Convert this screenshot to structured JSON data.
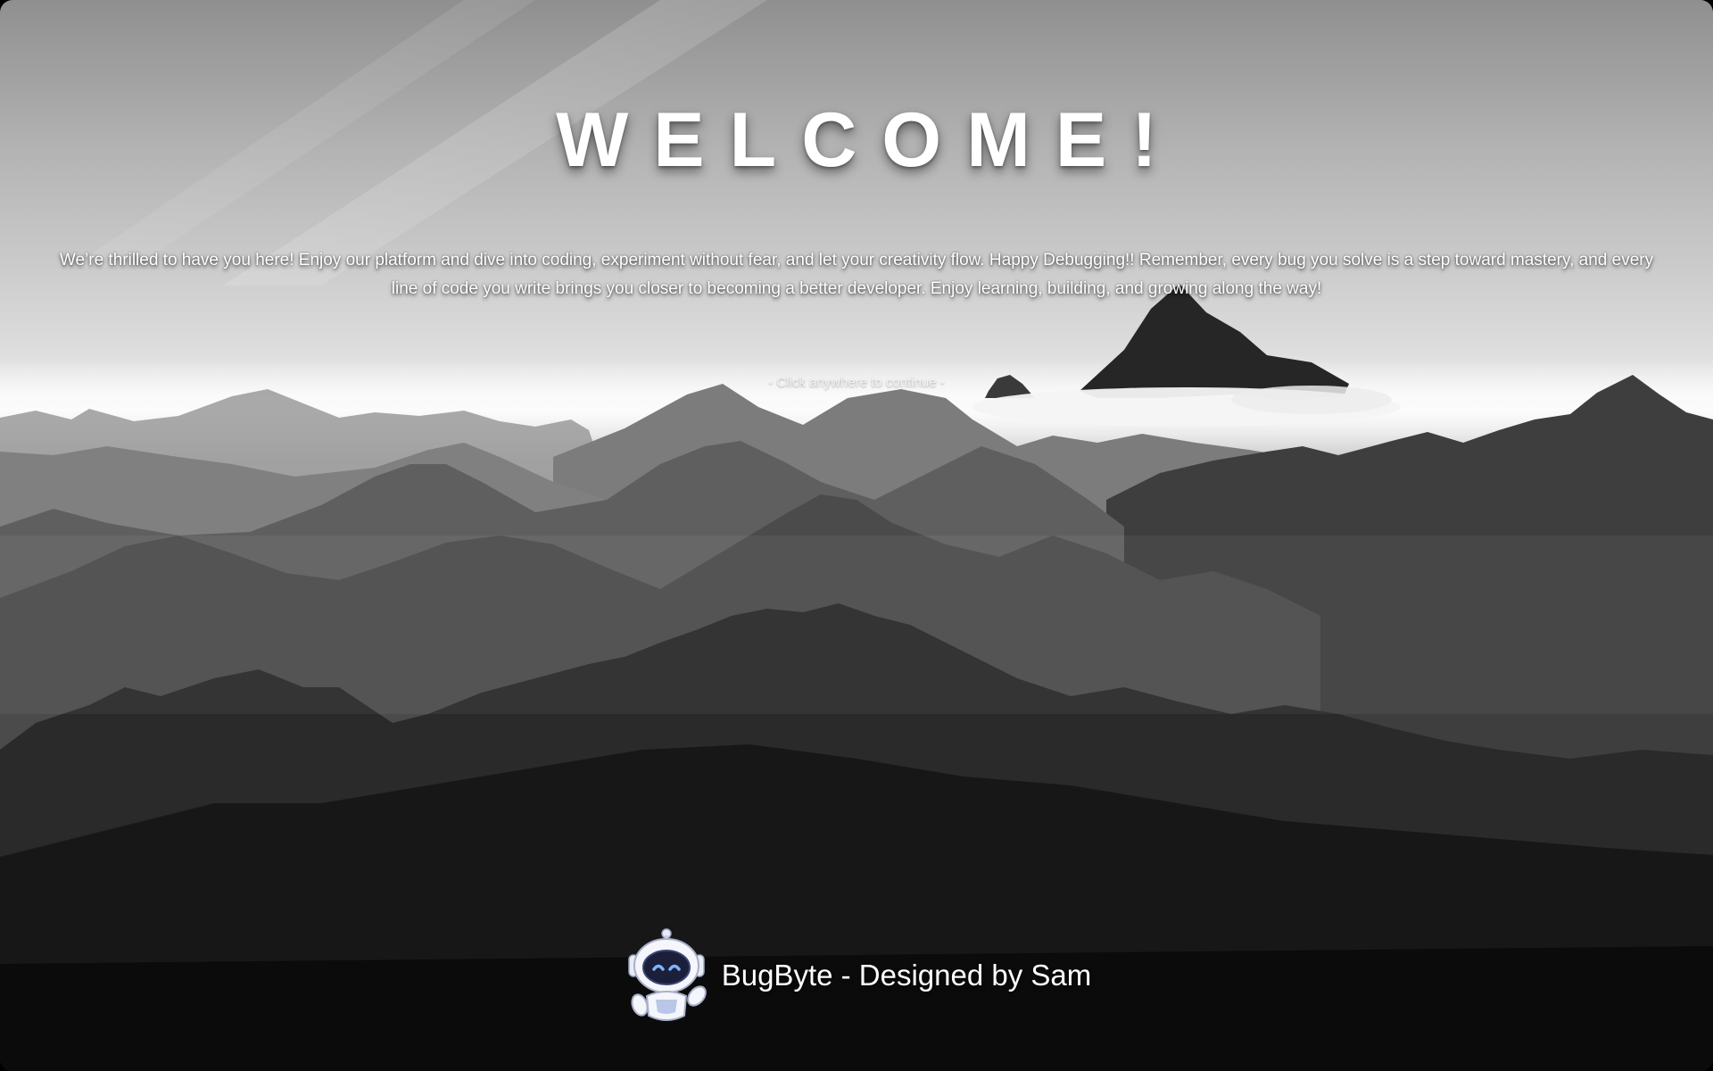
{
  "page": {
    "title": "WELCOME!",
    "message": "We’re thrilled to have you here! Enjoy our platform and dive into coding, experiment without fear, and let your creativity flow. Happy Debugging!! Remember, every bug you solve is a step toward mastery, and every line of code you write brings you closer to becoming a better developer. Enjoy learning, building, and growing along the way!",
    "continue_hint": "- Click anywhere to continue -"
  },
  "footer": {
    "logo_icon": "robot-icon",
    "credit": "BugByte - Designed by Sam"
  },
  "colors": {
    "text": "#ffffff",
    "background_sky": "#d6d6d6",
    "background_mountains": "#111111"
  }
}
